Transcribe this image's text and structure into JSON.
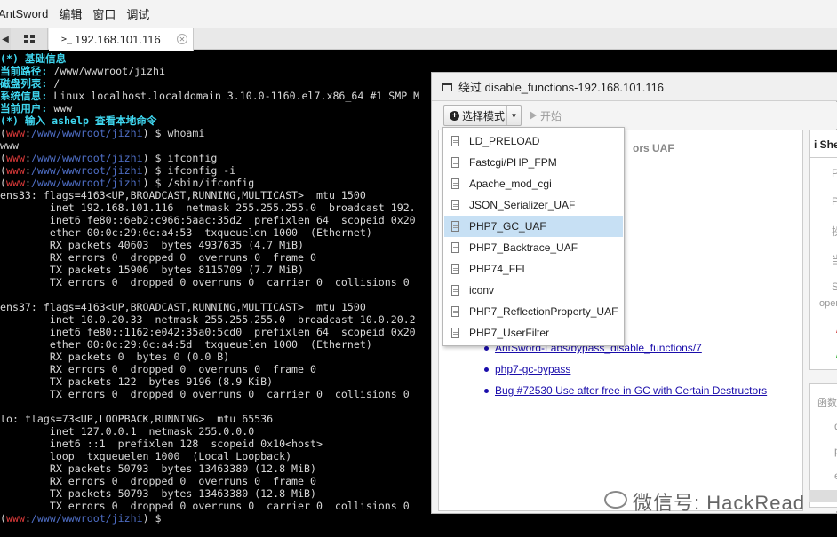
{
  "menubar": {
    "items": [
      "AntSword",
      "编辑",
      "窗口",
      "调试"
    ]
  },
  "tabs": {
    "active_label": "192.168.101.116",
    "term_glyph": ">_"
  },
  "terminal": {
    "lines": [
      {
        "segments": [
          {
            "t": "(*) 基础信息",
            "c": "c-cyan"
          }
        ]
      },
      {
        "segments": [
          {
            "t": "当前路径:",
            "c": "c-cyan"
          },
          {
            "t": " /www/wwwroot/jizhi",
            "c": ""
          }
        ]
      },
      {
        "segments": [
          {
            "t": "磁盘列表:",
            "c": "c-cyan"
          },
          {
            "t": " /",
            "c": ""
          }
        ]
      },
      {
        "segments": [
          {
            "t": "系统信息:",
            "c": "c-cyan"
          },
          {
            "t": " Linux localhost.localdomain 3.10.0-1160.el7.x86_64 #1 SMP M",
            "c": ""
          }
        ]
      },
      {
        "segments": [
          {
            "t": "当前用户:",
            "c": "c-cyan"
          },
          {
            "t": " www",
            "c": ""
          }
        ]
      },
      {
        "segments": [
          {
            "t": "(*) 输入 ashelp 查看本地命令",
            "c": "c-cyan"
          }
        ]
      },
      {
        "segments": [
          {
            "t": "(",
            "c": ""
          },
          {
            "t": "www",
            "c": "c-red"
          },
          {
            "t": ":",
            "c": ""
          },
          {
            "t": "/www/wwwroot/jizhi",
            "c": "c-path"
          },
          {
            "t": ") $ whoami",
            "c": ""
          }
        ]
      },
      {
        "segments": [
          {
            "t": "www",
            "c": ""
          }
        ]
      },
      {
        "segments": [
          {
            "t": "(",
            "c": ""
          },
          {
            "t": "www",
            "c": "c-red"
          },
          {
            "t": ":",
            "c": ""
          },
          {
            "t": "/www/wwwroot/jizhi",
            "c": "c-path"
          },
          {
            "t": ") $ ifconfig",
            "c": ""
          }
        ]
      },
      {
        "segments": [
          {
            "t": "(",
            "c": ""
          },
          {
            "t": "www",
            "c": "c-red"
          },
          {
            "t": ":",
            "c": ""
          },
          {
            "t": "/www/wwwroot/jizhi",
            "c": "c-path"
          },
          {
            "t": ") $ ifconfig -i",
            "c": ""
          }
        ]
      },
      {
        "segments": [
          {
            "t": "(",
            "c": ""
          },
          {
            "t": "www",
            "c": "c-red"
          },
          {
            "t": ":",
            "c": ""
          },
          {
            "t": "/www/wwwroot/jizhi",
            "c": "c-path"
          },
          {
            "t": ") $ /sbin/ifconfig",
            "c": ""
          }
        ]
      },
      {
        "segments": [
          {
            "t": "ens33: flags=4163<UP,BROADCAST,RUNNING,MULTICAST>  mtu 1500",
            "c": ""
          }
        ]
      },
      {
        "segments": [
          {
            "t": "        inet 192.168.101.116  netmask 255.255.255.0  broadcast 192.",
            "c": ""
          }
        ]
      },
      {
        "segments": [
          {
            "t": "        inet6 fe80::6eb2:c966:5aac:35d2  prefixlen 64  scopeid 0x20",
            "c": ""
          }
        ]
      },
      {
        "segments": [
          {
            "t": "        ether 00:0c:29:0c:a4:53  txqueuelen 1000  (Ethernet)",
            "c": ""
          }
        ]
      },
      {
        "segments": [
          {
            "t": "        RX packets 40603  bytes 4937635 (4.7 MiB)",
            "c": ""
          }
        ]
      },
      {
        "segments": [
          {
            "t": "        RX errors 0  dropped 0  overruns 0  frame 0",
            "c": ""
          }
        ]
      },
      {
        "segments": [
          {
            "t": "        TX packets 15906  bytes 8115709 (7.7 MiB)",
            "c": ""
          }
        ]
      },
      {
        "segments": [
          {
            "t": "        TX errors 0  dropped 0 overruns 0  carrier 0  collisions 0",
            "c": ""
          }
        ]
      },
      {
        "segments": [
          {
            "t": "",
            "c": ""
          }
        ]
      },
      {
        "segments": [
          {
            "t": "ens37: flags=4163<UP,BROADCAST,RUNNING,MULTICAST>  mtu 1500",
            "c": ""
          }
        ]
      },
      {
        "segments": [
          {
            "t": "        inet 10.0.20.33  netmask 255.255.255.0  broadcast 10.0.20.2",
            "c": ""
          }
        ]
      },
      {
        "segments": [
          {
            "t": "        inet6 fe80::1162:e042:35a0:5cd0  prefixlen 64  scopeid 0x20",
            "c": ""
          }
        ]
      },
      {
        "segments": [
          {
            "t": "        ether 00:0c:29:0c:a4:5d  txqueuelen 1000  (Ethernet)",
            "c": ""
          }
        ]
      },
      {
        "segments": [
          {
            "t": "        RX packets 0  bytes 0 (0.0 B)",
            "c": ""
          }
        ]
      },
      {
        "segments": [
          {
            "t": "        RX errors 0  dropped 0  overruns 0  frame 0",
            "c": ""
          }
        ]
      },
      {
        "segments": [
          {
            "t": "        TX packets 122  bytes 9196 (8.9 KiB)",
            "c": ""
          }
        ]
      },
      {
        "segments": [
          {
            "t": "        TX errors 0  dropped 0 overruns 0  carrier 0  collisions 0",
            "c": ""
          }
        ]
      },
      {
        "segments": [
          {
            "t": "",
            "c": ""
          }
        ]
      },
      {
        "segments": [
          {
            "t": "lo: flags=73<UP,LOOPBACK,RUNNING>  mtu 65536",
            "c": ""
          }
        ]
      },
      {
        "segments": [
          {
            "t": "        inet 127.0.0.1  netmask 255.0.0.0",
            "c": ""
          }
        ]
      },
      {
        "segments": [
          {
            "t": "        inet6 ::1  prefixlen 128  scopeid 0x10<host>",
            "c": ""
          }
        ]
      },
      {
        "segments": [
          {
            "t": "        loop  txqueuelen 1000  (Local Loopback)",
            "c": ""
          }
        ]
      },
      {
        "segments": [
          {
            "t": "        RX packets 50793  bytes 13463380 (12.8 MiB)",
            "c": ""
          }
        ]
      },
      {
        "segments": [
          {
            "t": "        RX errors 0  dropped 0  overruns 0  frame 0",
            "c": ""
          }
        ]
      },
      {
        "segments": [
          {
            "t": "        TX packets 50793  bytes 13463380 (12.8 MiB)",
            "c": ""
          }
        ]
      },
      {
        "segments": [
          {
            "t": "        TX errors 0  dropped 0 overruns 0  carrier 0  collisions 0",
            "c": ""
          }
        ]
      },
      {
        "segments": [
          {
            "t": "(",
            "c": ""
          },
          {
            "t": "www",
            "c": "c-red"
          },
          {
            "t": ":",
            "c": ""
          },
          {
            "t": "/www/wwwroot/jizhi",
            "c": "c-path"
          },
          {
            "t": ") $",
            "c": ""
          }
        ]
      }
    ]
  },
  "dialog": {
    "title": "绕过 disable_functions-192.168.101.116",
    "mode_button": "选择模式",
    "start_button": "开始",
    "heading_partial": "ors UAF",
    "links": [
      "AntSword-Labs/bypass_disable_functions/7",
      "php7-gc-bypass",
      "Bug #72530 Use after free in GC with Certain Destructors"
    ],
    "right_panel": {
      "head": "i She",
      "rows": [
        "PH",
        "PH",
        "操",
        "当",
        "Sh"
      ],
      "open_label": "open",
      "red_mark": "/",
      "green_mark": "/",
      "lower_label": "函数",
      "lower_rows": [
        "d",
        "p",
        "e"
      ]
    }
  },
  "dropdown": {
    "items": [
      "LD_PRELOAD",
      "Fastcgi/PHP_FPM",
      "Apache_mod_cgi",
      "JSON_Serializer_UAF",
      "PHP7_GC_UAF",
      "PHP7_Backtrace_UAF",
      "PHP74_FFI",
      "iconv",
      "PHP7_ReflectionProperty_UAF",
      "PHP7_UserFilter"
    ],
    "selected": "PHP7_GC_UAF"
  },
  "watermark": "微信号: HackRead"
}
